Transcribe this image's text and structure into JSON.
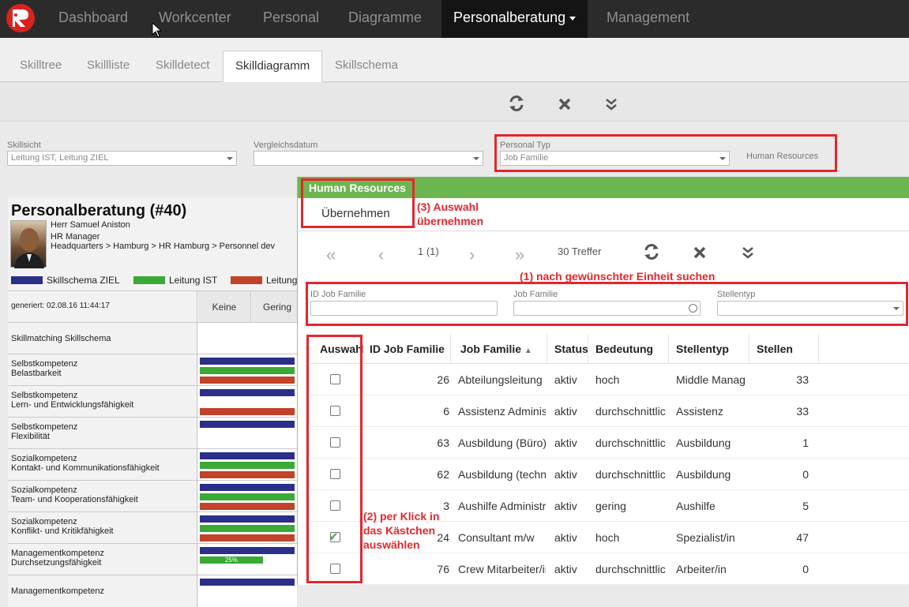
{
  "nav": {
    "items": [
      "Dashboard",
      "Workcenter",
      "Personal",
      "Diagramme",
      "Personalberatung",
      "Management"
    ],
    "active_index": 4
  },
  "subtabs": {
    "items": [
      "Skilltree",
      "Skillliste",
      "Skilldetect",
      "Skilldiagramm",
      "Skillschema"
    ],
    "active_index": 3
  },
  "filters": {
    "skillsicht_label": "Skillsicht",
    "skillsicht_value": "Leitung IST, Leitung ZIEL",
    "vergleichsdatum_label": "Vergleichsdatum",
    "vergleichsdatum_value": "",
    "personal_typ_label": "Personal Typ",
    "personal_typ_value": "Job Familie",
    "personal_typ_selected": "Human Resources"
  },
  "diagram": {
    "title": "Personalberatung (#40)",
    "person_name": "Herr Samuel Aniston",
    "person_role": "HR Manager",
    "person_path": "Headquarters > Hamburg > HR Hamburg > Personnel dev",
    "legend": [
      "Skillschema ZIEL",
      "Leitung IST",
      "Leitung"
    ],
    "legend_colors": [
      "#2b2f87",
      "#3aa935",
      "#c0432a"
    ],
    "generated": "generiert: 02.08.16 11:44:17",
    "col_keine": "Keine",
    "col_gering": "Gering",
    "rows": [
      {
        "l1": "Skillmatching Skillschema",
        "l2": ""
      },
      {
        "l1": "Selbstkompetenz",
        "l2": "Belastbarkeit"
      },
      {
        "l1": "Selbstkompetenz",
        "l2": "Lern- und Entwicklungsfähigkeit"
      },
      {
        "l1": "Selbstkompetenz",
        "l2": "Flexibilität"
      },
      {
        "l1": "Sozialkompetenz",
        "l2": "Kontakt- und Kommunikationsfähigkeit"
      },
      {
        "l1": "Sozialkompetenz",
        "l2": "Team- und Kooperationsfähigkeit"
      },
      {
        "l1": "Sozialkompetenz",
        "l2": "Konflikt- und Kritikfähigkeit"
      },
      {
        "l1": "Managementkompetenz",
        "l2": "Durchsetzungsfähigkeit"
      },
      {
        "l1": "Managementkompetenz",
        "l2": ""
      }
    ],
    "bar_percent_label": "25%"
  },
  "modal": {
    "title": "Human Resources",
    "apply_button": "Übernehmen",
    "page_info": "1 (1)",
    "hits": "30 Treffer",
    "filter_labels": [
      "ID Job Familie",
      "Job Familie",
      "Stellentyp"
    ],
    "columns": [
      "Auswahl",
      "ID Job Familie",
      "Job Familie",
      "Status",
      "Bedeutung",
      "Stellentyp",
      "Stellen"
    ],
    "sort_indicator": "▲",
    "rows": [
      {
        "id": "26",
        "job": "Abteilungsleitung",
        "status": "aktiv",
        "bedeutung": "hoch",
        "typ": "Middle Management",
        "stellen": "33",
        "checked": false
      },
      {
        "id": "6",
        "job": "Assistenz Administration",
        "status": "aktiv",
        "bedeutung": "durchschnittlich",
        "typ": "Assistenz",
        "stellen": "33",
        "checked": false
      },
      {
        "id": "63",
        "job": "Ausbildung (Büro)",
        "status": "aktiv",
        "bedeutung": "durchschnittlich",
        "typ": "Ausbildung",
        "stellen": "1",
        "checked": false
      },
      {
        "id": "62",
        "job": "Ausbildung (technisch)",
        "status": "aktiv",
        "bedeutung": "durchschnittlich",
        "typ": "Ausbildung",
        "stellen": "0",
        "checked": false
      },
      {
        "id": "3",
        "job": "Aushilfe Administration",
        "status": "aktiv",
        "bedeutung": "gering",
        "typ": "Aushilfe",
        "stellen": "5",
        "checked": false
      },
      {
        "id": "24",
        "job": "Consultant m/w",
        "status": "aktiv",
        "bedeutung": "hoch",
        "typ": "Spezialist/in",
        "stellen": "47",
        "checked": true
      },
      {
        "id": "76",
        "job": "Crew Mitarbeiter/in",
        "status": "aktiv",
        "bedeutung": "durchschnittlich",
        "typ": "Arbeiter/in",
        "stellen": "0",
        "checked": false
      }
    ]
  },
  "annotations": {
    "a1": "(1) nach gewünschter Einheit suchen",
    "a2_l1": "(2) per Klick in",
    "a2_l2": "das Kästchen",
    "a2_l3": "auswählen",
    "a3_l1": "(3) Auswahl",
    "a3_l2": "übernehmen"
  },
  "colors": {
    "accent_green": "#6cb64f",
    "annotation_red": "#e5262d",
    "nav_bg": "#2b2b2b"
  }
}
